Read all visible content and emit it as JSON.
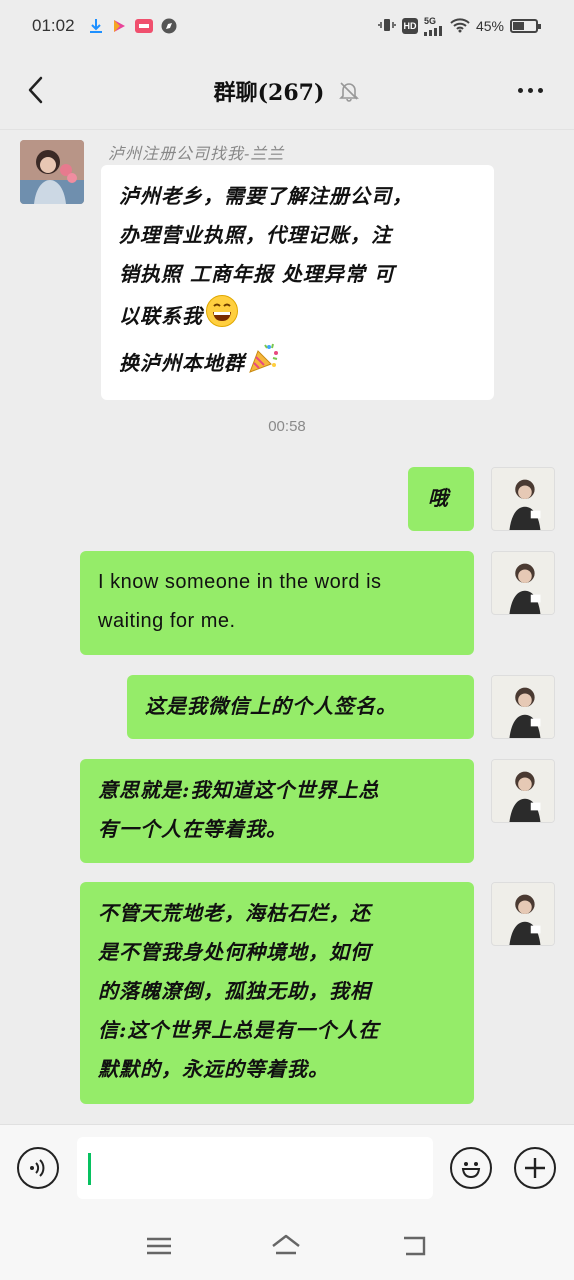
{
  "status_bar": {
    "time": "01:02",
    "network": "5G",
    "hd": "HD",
    "battery": "45%"
  },
  "header": {
    "title": "群聊(267)",
    "icons": [
      "back-chevron-icon",
      "mute-bell-icon",
      "more-dots-icon"
    ]
  },
  "messages": [
    {
      "side": "left",
      "sender": "泸州注册公司找我-兰兰",
      "lines": [
        "泸州老乡，需要了解注册公司，",
        "办理营业执照，代理记账，注",
        "销执照 工商年报 处理异常 可",
        "以联系我"
      ],
      "line5": "换泸州本地群"
    },
    {
      "side": "timestamp",
      "text": "00:58"
    },
    {
      "side": "right",
      "lines": [
        "哦"
      ]
    },
    {
      "side": "right",
      "lines": [
        "I know someone in the word is",
        "waiting for me."
      ]
    },
    {
      "side": "right",
      "lines": [
        "这是我微信上的个人签名。"
      ]
    },
    {
      "side": "right",
      "lines": [
        "意思就是:我知道这个世界上总",
        "有一个人在等着我。"
      ]
    },
    {
      "side": "right",
      "lines": [
        "不管天荒地老，海枯石烂，还",
        "是不管我身处何种境地，如何",
        "的落魄潦倒，孤独无助，我相",
        "信:这个世界上总是有一个人在",
        "默默的，永远的等着我。"
      ]
    }
  ],
  "input_bar": {
    "value": "",
    "icons": [
      "voice-icon",
      "emoji-icon",
      "plus-icon"
    ]
  },
  "colors": {
    "self_bubble": "#95ec69",
    "other_bubble": "#ffffff",
    "background": "#ededed",
    "cursor": "#07c160"
  }
}
